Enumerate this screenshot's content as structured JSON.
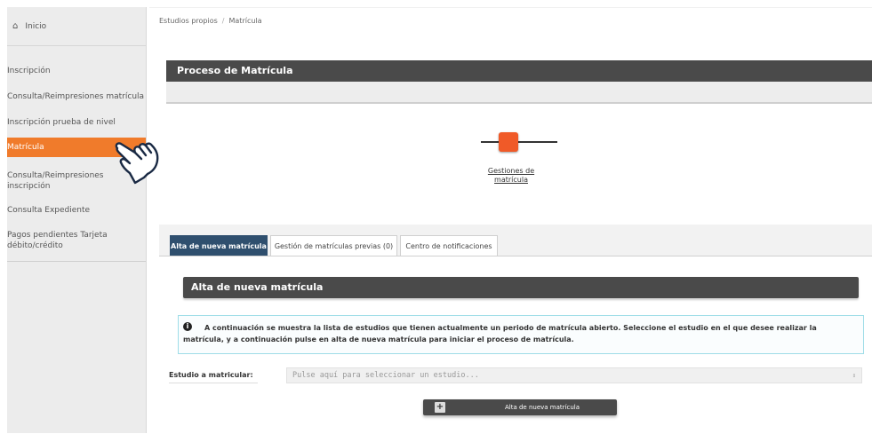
{
  "sidebar": {
    "home_icon": "home-icon",
    "home_label": "Inicio",
    "items": [
      {
        "label": "Inscripción"
      },
      {
        "label": "Consulta/Reimpresiones matrícula"
      },
      {
        "label": "Inscripción prueba de nivel"
      },
      {
        "label": "Matrícula"
      },
      {
        "label": "Consulta/Reimpresiones inscripción"
      },
      {
        "label": "Consulta Expediente"
      },
      {
        "label": "Pagos pendientes Tarjeta débito/crédito"
      }
    ]
  },
  "breadcrumb": {
    "parent": "Estudios propios",
    "separator": "/",
    "current": "Matrícula"
  },
  "process": {
    "title": "Proceso de Matrícula",
    "step_label": "Gestiones de matrícula",
    "step_color": "#f05a28"
  },
  "tabs": [
    {
      "label": "Alta de nueva matrícula",
      "active": true
    },
    {
      "label": "Gestión de matrículas previas (0)",
      "active": false
    },
    {
      "label": "Centro de notificaciones",
      "active": false
    }
  ],
  "form": {
    "title": "Alta de nueva matrícula",
    "info_icon": "info-icon",
    "info_text": "A continuación se muestra la lista de estudios que tienen actualmente un periodo de matrícula abierto. Seleccione el estudio en el que desee realizar la matrícula, y a continuación pulse en alta de nueva matrícula para iniciar el proceso de matrícula.",
    "field_label": "Estudio a matricular:",
    "select_placeholder": "Pulse aquí para seleccionar un estudio...",
    "submit_label": "Alta de nueva matrícula"
  },
  "colors": {
    "accent": "#f07b2b",
    "header_dark": "#4a4a4a",
    "tab_active": "#2f4f6e"
  }
}
